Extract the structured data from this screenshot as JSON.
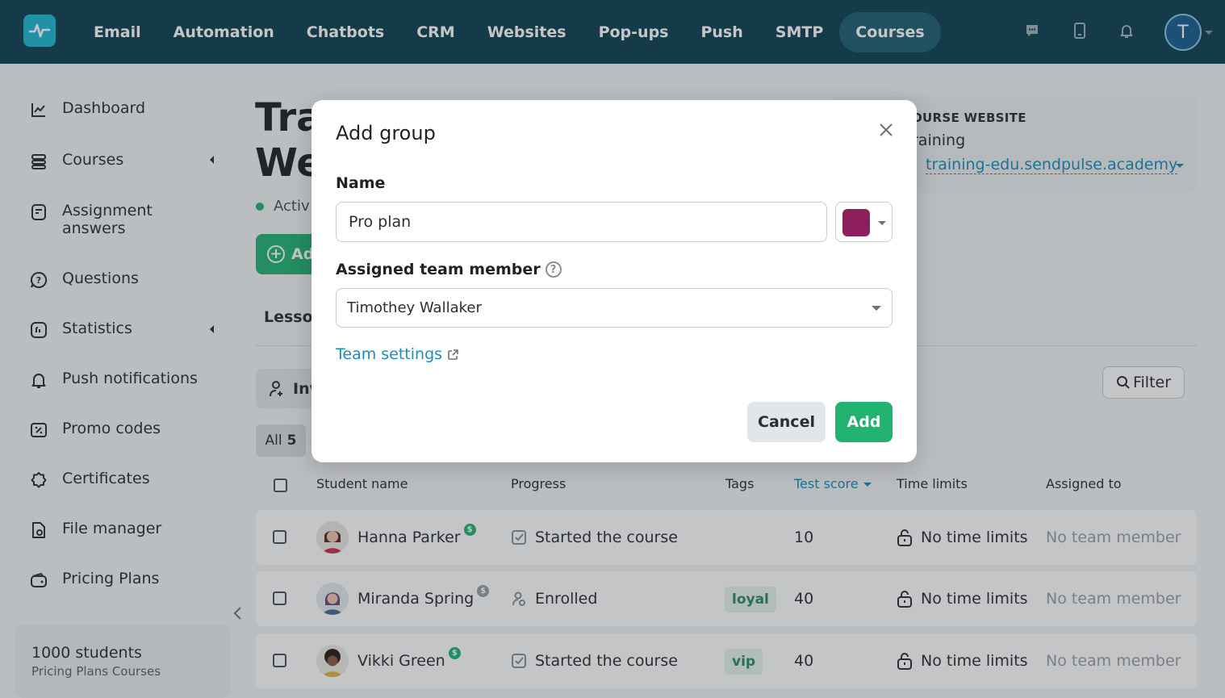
{
  "topnav": {
    "items": [
      "Email",
      "Automation",
      "Chatbots",
      "CRM",
      "Websites",
      "Pop-ups",
      "Push",
      "SMTP",
      "Courses"
    ],
    "active_item": "Courses",
    "avatar_initial": "T",
    "icons": [
      "chat-icon",
      "phone-icon",
      "bell-icon"
    ]
  },
  "sidebar": {
    "items": [
      {
        "label": "Dashboard",
        "icon": "chart-icon"
      },
      {
        "label": "Courses",
        "icon": "layers-icon"
      },
      {
        "label": "Assignment answers",
        "icon": "assignment-icon"
      },
      {
        "label": "Questions",
        "icon": "question-icon"
      },
      {
        "label": "Statistics",
        "icon": "stats-icon"
      },
      {
        "label": "Push notifications",
        "icon": "bell-icon"
      },
      {
        "label": "Promo codes",
        "icon": "percent-icon"
      },
      {
        "label": "Certificates",
        "icon": "certificate-icon"
      },
      {
        "label": "File manager",
        "icon": "file-icon"
      },
      {
        "label": "Pricing Plans",
        "icon": "wallet-icon"
      }
    ],
    "plan": {
      "line1": "1000 students",
      "line2": "Pricing Plans Courses"
    }
  },
  "main": {
    "title_line1": "Tra",
    "title_line2": "We",
    "status": "Activ",
    "add_button": "Ad",
    "tab_lessons": "Lesso",
    "invite_button": "Inv",
    "filter_button": "Filter",
    "all_chip": {
      "label": "All",
      "count": "5"
    }
  },
  "course_site": {
    "label": "OURSE WEBSITE",
    "name": "raining",
    "link": "training-edu.sendpulse.academy"
  },
  "table": {
    "headers": [
      "Student name",
      "Progress",
      "Tags",
      "Test score",
      "Time limits",
      "Assigned to"
    ],
    "sorted_column": "Test score",
    "rows": [
      {
        "name": "Hanna Parker",
        "coin_color": "#22b372",
        "progress": "Started the course",
        "progress_icon": "check-icon",
        "tag": "",
        "score": "10",
        "time_limit": "No time limits",
        "assigned": "No team member"
      },
      {
        "name": "Miranda Spring",
        "coin_color": "#9aa0a5",
        "progress": "Enrolled",
        "progress_icon": "user-icon",
        "tag": "loyal",
        "score": "40",
        "time_limit": "No time limits",
        "assigned": "No team member"
      },
      {
        "name": "Vikki Green",
        "coin_color": "#22b372",
        "progress": "Started the course",
        "progress_icon": "check-icon",
        "tag": "vip",
        "score": "40",
        "time_limit": "No time limits",
        "assigned": "No team member"
      }
    ]
  },
  "modal": {
    "title": "Add group",
    "name_label": "Name",
    "name_value": "Pro plan",
    "color": "#8e1f5d",
    "member_label": "Assigned team member",
    "member_value": "Timothey Wallaker",
    "team_settings_link": "Team settings",
    "cancel": "Cancel",
    "add": "Add"
  },
  "colors": {
    "nav_bg": "#0f3f52",
    "accent_green": "#22b372",
    "link_blue": "#1b8cb8"
  }
}
